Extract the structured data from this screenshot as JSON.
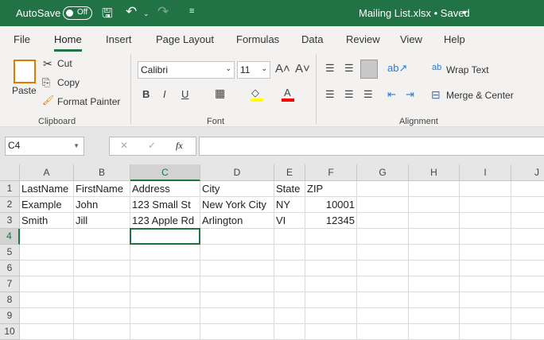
{
  "titlebar": {
    "autosave_label": "AutoSave",
    "autosave_state": "Off",
    "document_title": "Mailing List.xlsx • Saved",
    "accent": "#217346"
  },
  "menu": {
    "tabs": [
      "File",
      "Home",
      "Insert",
      "Page Layout",
      "Formulas",
      "Data",
      "Review",
      "View",
      "Help"
    ],
    "active": "Home"
  },
  "ribbon": {
    "clipboard": {
      "paste": "Paste",
      "cut": "Cut",
      "copy": "Copy",
      "format_painter": "Format Painter",
      "group": "Clipboard"
    },
    "font": {
      "font_name": "Calibri",
      "font_size": "11",
      "bold": "B",
      "italic": "I",
      "underline": "U",
      "group": "Font",
      "highlight_color": "#ffff00",
      "font_color": "#ff0000"
    },
    "alignment": {
      "wrap_text": "Wrap Text",
      "merge_center": "Merge & Center",
      "group": "Alignment"
    }
  },
  "formula_bar": {
    "name_box": "C4",
    "fx": "fx",
    "value": ""
  },
  "sheet": {
    "columns": [
      "A",
      "B",
      "C",
      "D",
      "E",
      "F",
      "G",
      "H",
      "I",
      "J"
    ],
    "rows": [
      "1",
      "2",
      "3",
      "4",
      "5",
      "6",
      "7",
      "8",
      "9",
      "10"
    ],
    "selected_cell": "C4",
    "data": [
      [
        "LastName",
        "FirstName",
        "Address",
        "City",
        "State",
        "ZIP"
      ],
      [
        "Example",
        "John",
        "123 Small St",
        "New York City",
        "NY",
        "10001"
      ],
      [
        "Smith",
        "Jill",
        "123 Apple Rd",
        "Arlington",
        "VI",
        "12345"
      ]
    ]
  }
}
